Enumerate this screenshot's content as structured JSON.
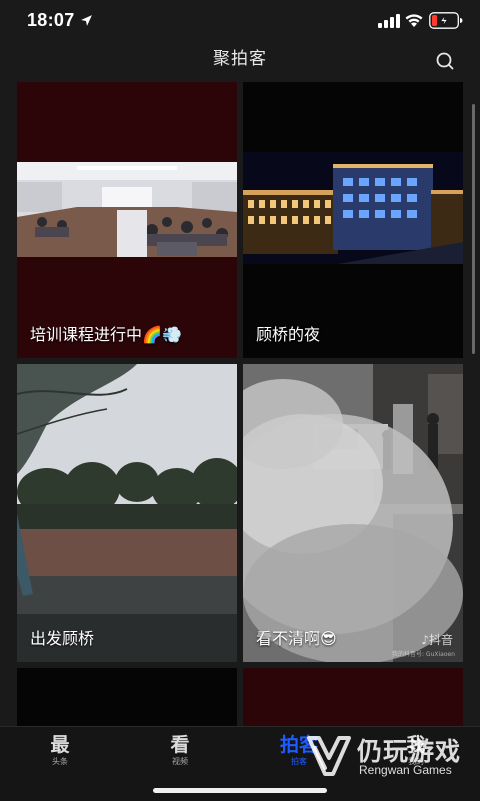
{
  "status_bar": {
    "time": "18:07",
    "icons": [
      "location-arrow-icon",
      "signal-bars-icon",
      "wifi-icon",
      "battery-low-charging-icon"
    ]
  },
  "header": {
    "title": "聚拍客",
    "search_icon": "search-icon"
  },
  "feed": {
    "cards": [
      {
        "caption": "培训课程进行中",
        "emoji": "🌈💨"
      },
      {
        "caption": "顾桥的夜",
        "emoji": ""
      },
      {
        "caption": "出发顾桥",
        "emoji": ""
      },
      {
        "caption": "看不清啊",
        "emoji": "😎"
      },
      {
        "caption": "",
        "emoji": ""
      },
      {
        "caption": "",
        "emoji": ""
      }
    ],
    "douyin_mark": "抖音",
    "douyin_id": "我的抖音号: GuXiaoen"
  },
  "tab_bar": {
    "tabs": [
      {
        "icon": "最",
        "label": "头条",
        "active": false
      },
      {
        "icon": "看",
        "label": "视频",
        "active": false
      },
      {
        "icon": "拍客",
        "label": "拍客",
        "active": true
      },
      {
        "icon": "我",
        "label": "我的",
        "active": false
      }
    ]
  },
  "watermark": {
    "cn": "仍玩游戏",
    "en": "Rengwan Games"
  },
  "colors": {
    "background": "#1a1a1a",
    "accent": "#1f5cff",
    "battery_low": "#ff3b30"
  }
}
